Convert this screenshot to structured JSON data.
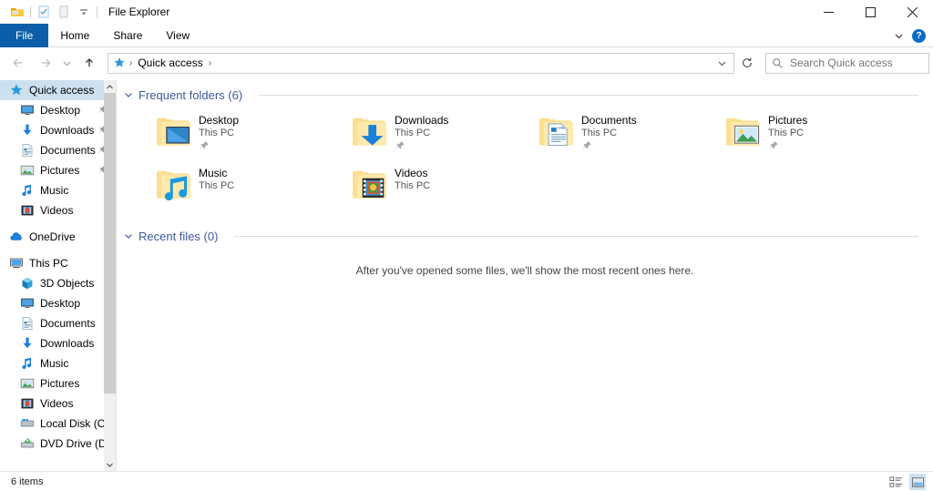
{
  "window": {
    "title": "File Explorer",
    "quick_access_toolbar": [
      {
        "name": "folder-icon",
        "label": "Folder"
      },
      {
        "name": "properties-icon",
        "label": "Properties"
      },
      {
        "name": "new-folder-icon",
        "label": "New folder"
      },
      {
        "name": "customize-dropdown-icon",
        "label": "Customize Quick Access Toolbar"
      }
    ],
    "controls": {
      "minimize": "–",
      "maximize": "☐",
      "close": "✕"
    }
  },
  "ribbon": {
    "tabs": [
      {
        "label": "File",
        "active": true
      },
      {
        "label": "Home",
        "active": false
      },
      {
        "label": "Share",
        "active": false
      },
      {
        "label": "View",
        "active": false
      }
    ],
    "collapse_label": "∨",
    "help_label": "?"
  },
  "address": {
    "back_label": "←",
    "forward_label": "→",
    "history_label": "∨",
    "up_label": "↑",
    "pin_icon": "star-pin-icon",
    "crumbs": [
      "Quick access"
    ],
    "separator": "›",
    "dropdown_label": "∨",
    "refresh_label": "↻"
  },
  "search": {
    "placeholder": "Search Quick access",
    "icon": "search-icon"
  },
  "sidebar": {
    "items": [
      {
        "label": "Quick access",
        "icon": "star-pin-icon",
        "level": 1,
        "selected": true,
        "pinned": false
      },
      {
        "label": "Desktop",
        "icon": "desktop-icon",
        "level": 2,
        "selected": false,
        "pinned": true
      },
      {
        "label": "Downloads",
        "icon": "downloads-icon",
        "level": 2,
        "selected": false,
        "pinned": true
      },
      {
        "label": "Documents",
        "icon": "documents-icon",
        "level": 2,
        "selected": false,
        "pinned": true
      },
      {
        "label": "Pictures",
        "icon": "pictures-icon",
        "level": 2,
        "selected": false,
        "pinned": true
      },
      {
        "label": "Music",
        "icon": "music-icon",
        "level": 2,
        "selected": false,
        "pinned": false
      },
      {
        "label": "Videos",
        "icon": "videos-icon",
        "level": 2,
        "selected": false,
        "pinned": false
      },
      {
        "gap": true
      },
      {
        "label": "OneDrive",
        "icon": "onedrive-cloud-icon",
        "level": 1,
        "selected": false,
        "pinned": false
      },
      {
        "gap": true
      },
      {
        "label": "This PC",
        "icon": "this-pc-icon",
        "level": 1,
        "selected": false,
        "pinned": false
      },
      {
        "label": "3D Objects",
        "icon": "3d-objects-icon",
        "level": 2,
        "selected": false,
        "pinned": false
      },
      {
        "label": "Desktop",
        "icon": "desktop-icon",
        "level": 2,
        "selected": false,
        "pinned": false
      },
      {
        "label": "Documents",
        "icon": "documents-icon",
        "level": 2,
        "selected": false,
        "pinned": false
      },
      {
        "label": "Downloads",
        "icon": "downloads-icon",
        "level": 2,
        "selected": false,
        "pinned": false
      },
      {
        "label": "Music",
        "icon": "music-icon",
        "level": 2,
        "selected": false,
        "pinned": false
      },
      {
        "label": "Pictures",
        "icon": "pictures-icon",
        "level": 2,
        "selected": false,
        "pinned": false
      },
      {
        "label": "Videos",
        "icon": "videos-icon",
        "level": 2,
        "selected": false,
        "pinned": false
      },
      {
        "label": "Local Disk (C:)",
        "icon": "hard-drive-icon",
        "level": 2,
        "selected": false,
        "pinned": false
      },
      {
        "label": "DVD Drive (D:) E",
        "icon": "dvd-drive-icon",
        "level": 2,
        "selected": false,
        "pinned": false
      }
    ],
    "scrollbar": {
      "up_arrow": "∧",
      "down_arrow": "∨"
    }
  },
  "content": {
    "groups": [
      {
        "title": "Frequent folders (6)",
        "chevron": "∨"
      },
      {
        "title": "Recent files (0)",
        "chevron": "∨"
      }
    ],
    "frequent_folders": [
      {
        "name": "Desktop",
        "location": "This PC",
        "icon": "folder-desktop-icon",
        "pinned": true
      },
      {
        "name": "Downloads",
        "location": "This PC",
        "icon": "folder-downloads-icon",
        "pinned": true
      },
      {
        "name": "Documents",
        "location": "This PC",
        "icon": "folder-documents-icon",
        "pinned": true
      },
      {
        "name": "Pictures",
        "location": "This PC",
        "icon": "folder-pictures-icon",
        "pinned": true
      },
      {
        "name": "Music",
        "location": "This PC",
        "icon": "folder-music-icon",
        "pinned": false
      },
      {
        "name": "Videos",
        "location": "This PC",
        "icon": "folder-videos-icon",
        "pinned": false
      }
    ],
    "recent_files_empty_message": "After you've opened some files, we'll show the most recent ones here."
  },
  "statusbar": {
    "item_count": "6 items",
    "views": [
      {
        "name": "details-view-button",
        "active": false
      },
      {
        "name": "large-icons-view-button",
        "active": true
      }
    ]
  },
  "colors": {
    "accent": "#0a5fa8",
    "group_header": "#3c5a9a",
    "selection": "#cce0f0",
    "folder_yellow": "#ffd77a"
  }
}
